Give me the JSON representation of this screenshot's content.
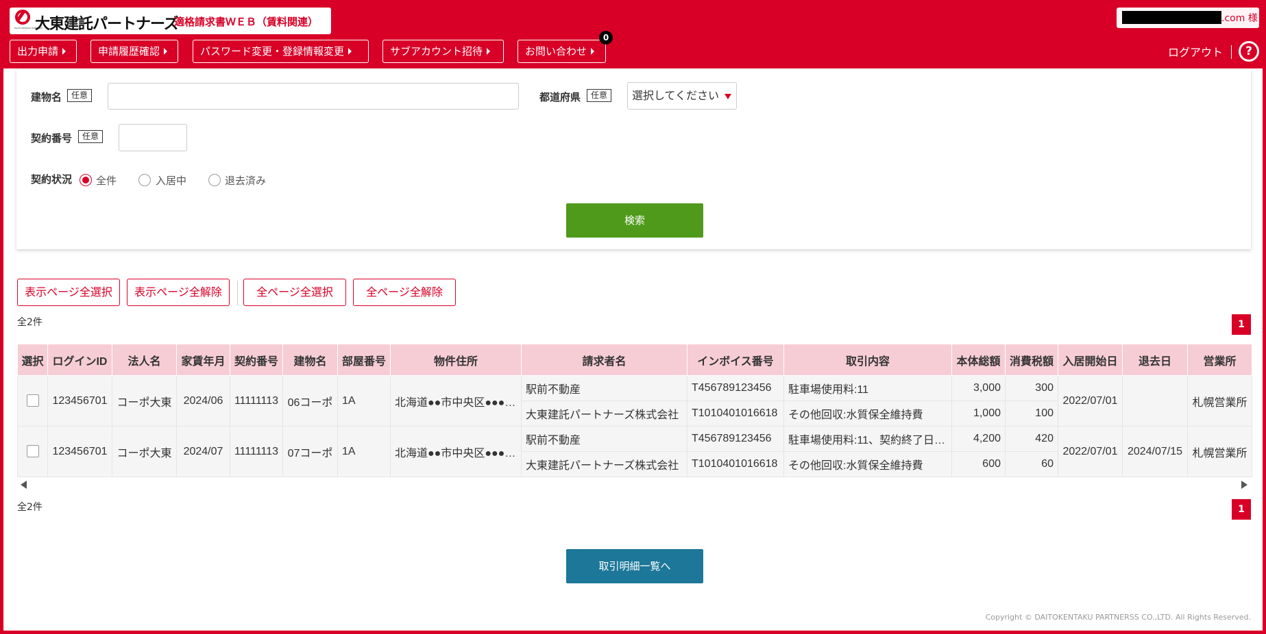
{
  "header": {
    "logo_name": "大東建託パートナーズ",
    "logo_sub": "DAITO KENTAKU PARTNERS",
    "title": "適格請求書ＷＥＢ（賃料関連）",
    "user_suffix": ".com 様",
    "nav": [
      {
        "label": "出力申請"
      },
      {
        "label": "申請履歴確認"
      },
      {
        "label": "パスワード変更・登録情報変更"
      },
      {
        "label": "サブアカウント招待"
      },
      {
        "label": "お問い合わせ"
      }
    ],
    "inquiry_badge": "0",
    "logout_label": "ログアウト",
    "help_label": "?"
  },
  "colors": {
    "brand": "#d80027",
    "search": "#4f9a1b",
    "list": "#1c7799",
    "table_header": "#f6cdd5"
  },
  "form": {
    "building_label": "建物名",
    "optional_tag": "任意",
    "building_value": "",
    "prefecture_label": "都道府県",
    "prefecture_value": "選択してください",
    "contract_no_label": "契約番号",
    "contract_no_value": "",
    "status_label": "契約状況",
    "status_options": [
      {
        "label": "全件",
        "checked": true
      },
      {
        "label": "入居中",
        "checked": false
      },
      {
        "label": "退去済み",
        "checked": false
      }
    ],
    "search_label": "検索"
  },
  "select_buttons": [
    "表示ページ全選択",
    "表示ページ全解除",
    "全ページ全選択",
    "全ページ全解除"
  ],
  "result_count": "全2件",
  "page_number": "1",
  "table": {
    "columns": [
      "選択",
      "ログインID",
      "法人名",
      "家賃年月",
      "契約番号",
      "建物名",
      "部屋番号",
      "物件住所",
      "請求者名",
      "インボイス番号",
      "取引内容",
      "本体総額",
      "消費税額",
      "入居開始日",
      "退去日",
      "営業所"
    ],
    "rows": [
      {
        "login_id": "123456701",
        "company": "コーポ大東",
        "rent_month": "2024/06",
        "contract_no": "11111113",
        "building": "06コーポ",
        "room": "1A",
        "address": "北海道●●市中央区●●●…",
        "move_in": "2022/07/01",
        "move_out": "",
        "office": "札幌営業所",
        "lines": [
          {
            "biller": "駅前不動産",
            "invoice": "T456789123456",
            "content": "駐車場使用料:11",
            "amount": "3,000",
            "tax": "300"
          },
          {
            "biller": "大東建託パートナーズ株式会社",
            "invoice": "T1010401016618",
            "content": "その他回収:水質保全維持費",
            "amount": "1,000",
            "tax": "100"
          }
        ]
      },
      {
        "login_id": "123456701",
        "company": "コーポ大東",
        "rent_month": "2024/07",
        "contract_no": "11111113",
        "building": "07コーポ",
        "room": "1A",
        "address": "北海道●●市中央区●●●…",
        "move_in": "2022/07/01",
        "move_out": "2024/07/15",
        "office": "札幌営業所",
        "lines": [
          {
            "biller": "駅前不動産",
            "invoice": "T456789123456",
            "content": "駐車場使用料:11、契約終了日…",
            "amount": "4,200",
            "tax": "420"
          },
          {
            "biller": "大東建託パートナーズ株式会社",
            "invoice": "T1010401016618",
            "content": "その他回収:水質保全維持費",
            "amount": "600",
            "tax": "60"
          }
        ]
      }
    ]
  },
  "list_button_label": "取引明細一覧へ",
  "copyright": "Copyright © DAITOKENTAKU PARTNERSS CO.,LTD. All Rights Reserved."
}
